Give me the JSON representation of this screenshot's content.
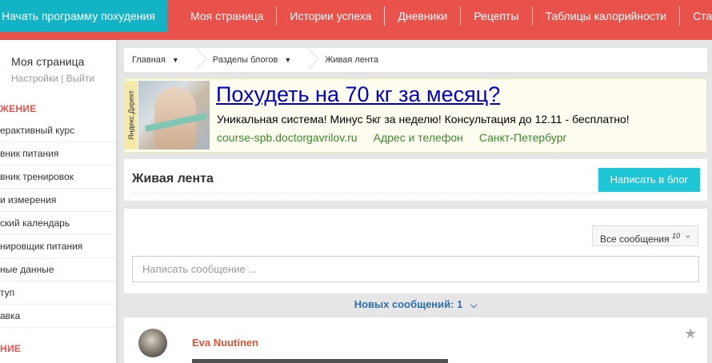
{
  "colors": {
    "nav_bg": "#e8524a",
    "start_btn_bg": "#12b3c4",
    "accent_button": "#1ec6d6",
    "section_title": "#e8524a",
    "ad_title_link": "#0000cc",
    "ad_links": "#3a8a2e",
    "new_messages": "#2d6fa8",
    "author_name": "#e0533b"
  },
  "topnav": {
    "start_program": "Начать программу похудения",
    "items": [
      {
        "label": "Моя страница"
      },
      {
        "label": "Истории успеха"
      },
      {
        "label": "Дневники"
      },
      {
        "label": "Рецепты"
      },
      {
        "label": "Таблицы калорийности"
      },
      {
        "label": "Ста"
      }
    ]
  },
  "sidebar": {
    "user_name": "Моя страница",
    "settings_link": "Настройки",
    "link_separator": "|",
    "logout_link": "Выйти",
    "section1_title": "ЖЕНИЕ",
    "items": [
      {
        "label": "ерактивный курс"
      },
      {
        "label": "вник питания"
      },
      {
        "label": "вник тренировок"
      },
      {
        "label": "и измерения"
      },
      {
        "label": "ский календарь"
      },
      {
        "label": "нировщик питания"
      },
      {
        "label": "ные данные"
      },
      {
        "label": "туп"
      },
      {
        "label": "авка"
      }
    ],
    "section2_title": "НИЕ"
  },
  "breadcrumb": {
    "home": "Главная",
    "sections": "Разделы блогов",
    "current": "Живая лента",
    "caret_icon": "chevron-down-icon"
  },
  "ad": {
    "tag": "Яндекс.Директ",
    "title": "Похудеть на 70 кг за месяц?",
    "text": "Уникальная система! Минус 5кг за неделю! Консультация до 12.11 - бесплатно!",
    "link_domain": "course-spb.doctorgavrilov.ru",
    "link_contacts": "Адрес и телефон",
    "link_city": "Санкт-Петербург"
  },
  "feed": {
    "title": "Живая лента",
    "write_blog_button": "Написать в блог"
  },
  "messages": {
    "filter_label": "Все сообщения",
    "filter_count": "10",
    "input_placeholder": "Написать сообщение ...",
    "new_messages_text": "Новых сообщений: 1"
  },
  "post": {
    "author": "Eva Nuutinen",
    "star_icon": "star-icon"
  }
}
